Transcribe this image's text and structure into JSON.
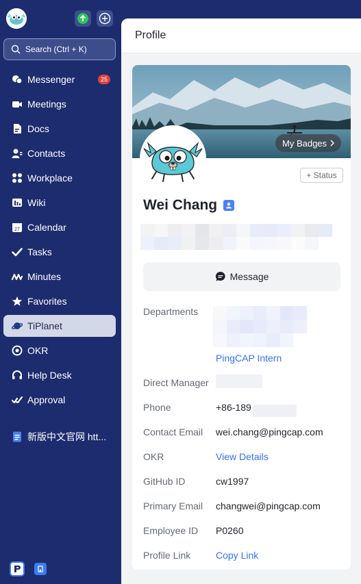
{
  "sidebar": {
    "search_label": "Search (Ctrl + K)",
    "items": [
      {
        "label": "Messenger",
        "icon": "messenger-icon",
        "badge": "25"
      },
      {
        "label": "Meetings",
        "icon": "video-camera-icon"
      },
      {
        "label": "Docs",
        "icon": "docs-icon"
      },
      {
        "label": "Contacts",
        "icon": "contacts-icon"
      },
      {
        "label": "Workplace",
        "icon": "workplace-grid-icon"
      },
      {
        "label": "Wiki",
        "icon": "wiki-icon"
      },
      {
        "label": "Calendar",
        "icon": "calendar-icon",
        "icon_text": "27"
      },
      {
        "label": "Tasks",
        "icon": "check-icon"
      },
      {
        "label": "Minutes",
        "icon": "minutes-icon"
      },
      {
        "label": "Favorites",
        "icon": "star-icon"
      },
      {
        "label": "TiPlanet",
        "icon": "planet-icon",
        "active": true
      },
      {
        "label": "OKR",
        "icon": "okr-icon"
      },
      {
        "label": "Help Desk",
        "icon": "headset-icon"
      },
      {
        "label": "Approval",
        "icon": "approval-icon"
      }
    ],
    "pinned": {
      "label": "新版中文官网 htt...",
      "icon": "document-icon"
    }
  },
  "main": {
    "title": "Profile",
    "badges_label": "My Badges",
    "status_label": "+ Status",
    "name": "Wei Chang",
    "message_label": "Message",
    "fields": {
      "departments": {
        "label": "Departments",
        "value": "PingCAP Intern"
      },
      "direct_manager": {
        "label": "Direct Manager"
      },
      "phone": {
        "label": "Phone",
        "value": "+86-189"
      },
      "contact_email": {
        "label": "Contact Email",
        "value": "wei.chang@pingcap.com"
      },
      "okr": {
        "label": "OKR",
        "value": "View Details"
      },
      "github": {
        "label": "GitHub ID",
        "value": "cw1997"
      },
      "primary_email": {
        "label": "Primary Email",
        "value": "changwei@pingcap.com"
      },
      "employee_id": {
        "label": "Employee ID",
        "value": "P0260"
      },
      "profile_link": {
        "label": "Profile Link",
        "value": "Copy Link"
      }
    }
  },
  "colors": {
    "sidebar_bg": "#1c2c6e",
    "accent_link": "#3370ff",
    "badge_red": "#e0413d",
    "active_item_bg": "#d3d8e8"
  }
}
